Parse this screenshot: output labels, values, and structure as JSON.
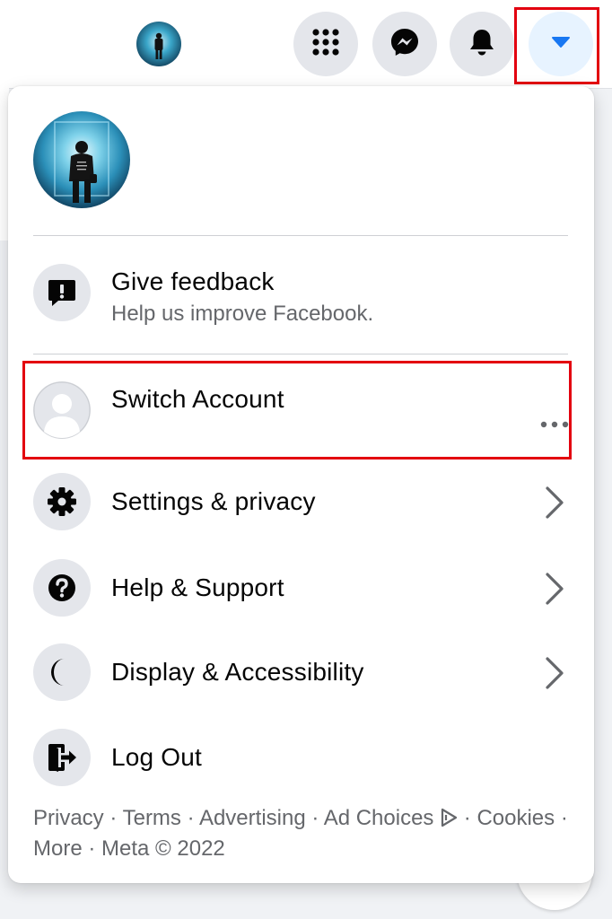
{
  "topbar": {
    "menu_button_label": "Menu",
    "messenger_button_label": "Messenger",
    "notifications_button_label": "Notifications",
    "account_button_label": "Account"
  },
  "menu": {
    "feedback": {
      "label": "Give feedback",
      "sublabel": "Help us improve Facebook."
    },
    "switch_account": {
      "label": "Switch Account"
    },
    "settings": {
      "label": "Settings & privacy"
    },
    "help": {
      "label": "Help & Support"
    },
    "display": {
      "label": "Display & Accessibility"
    },
    "logout": {
      "label": "Log Out"
    }
  },
  "footer": {
    "links": [
      "Privacy",
      "Terms",
      "Advertising",
      "Ad Choices",
      "Cookies",
      "More"
    ],
    "separator": " · ",
    "copyright": "Meta © 2022"
  },
  "colors": {
    "accent": "#1877f2",
    "highlight": "#e3000f",
    "icon_bg": "#e4e6eb",
    "secondary_text": "#65676b"
  },
  "icons": [
    "grid-menu-icon",
    "messenger-icon",
    "bell-icon",
    "caret-down-icon",
    "feedback-icon",
    "default-avatar-icon",
    "more-dots-icon",
    "gear-icon",
    "help-icon",
    "moon-icon",
    "logout-icon",
    "chevron-right-icon",
    "ad-choices-icon"
  ]
}
